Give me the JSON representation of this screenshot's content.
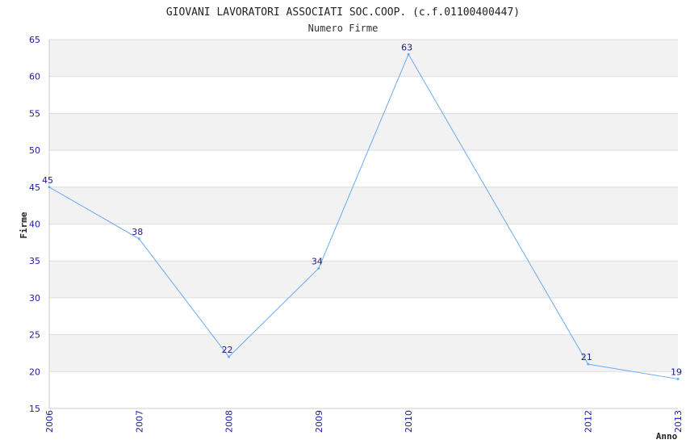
{
  "title": "GIOVANI LAVORATORI ASSOCIATI SOC.COOP. (c.f.01100400447)",
  "subtitle": "Numero Firme",
  "chart_data": {
    "type": "line",
    "title": "GIOVANI LAVORATORI ASSOCIATI SOC.COOP. (c.f.01100400447)",
    "subtitle": "Numero Firme",
    "xlabel": "Anno",
    "ylabel": "Firme",
    "x": [
      2006,
      2007,
      2008,
      2009,
      2010,
      2012,
      2013
    ],
    "categories": [
      "2006",
      "2007",
      "2008",
      "2009",
      "2010",
      "2012",
      "2013"
    ],
    "values": [
      45,
      38,
      22,
      34,
      63,
      21,
      19
    ],
    "ylim": [
      15,
      65
    ],
    "yticks": [
      15,
      20,
      25,
      30,
      35,
      40,
      45,
      50,
      55,
      60,
      65
    ],
    "grid": true,
    "colors": {
      "line": "#6aaaf0",
      "band": "#f2f2f2",
      "gridline": "#dddddd",
      "tick_text": "#1a1aa6",
      "data_label": "#1a1a80"
    }
  }
}
